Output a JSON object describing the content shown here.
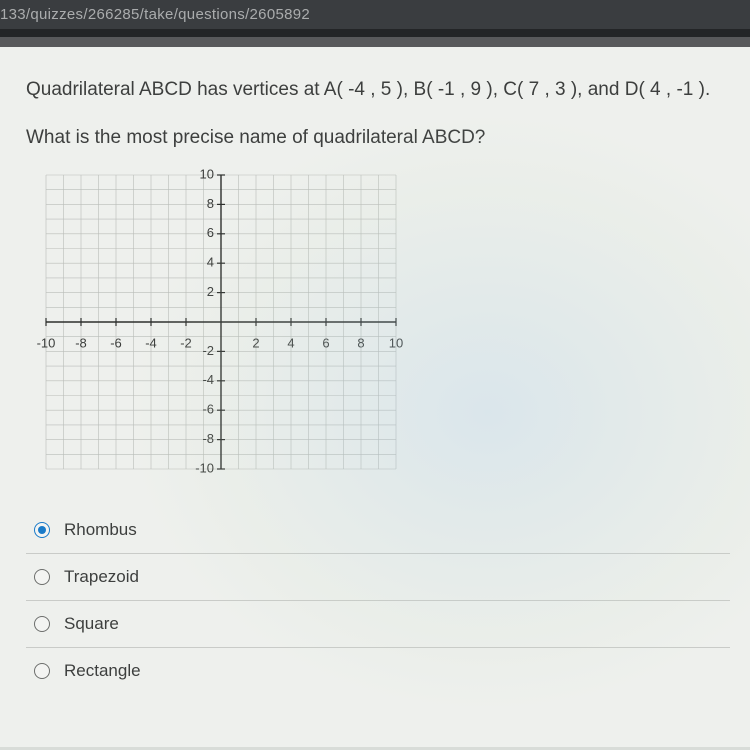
{
  "address_bar": "133/quizzes/266285/take/questions/2605892",
  "question": {
    "line1": "Quadrilateral ABCD has vertices at  A( -4 , 5 ),   B( -1 , 9 ),   C( 7 , 3 ), and   D( 4 , -1 ).",
    "line2": "What is the most precise name of quadrilateral ABCD?"
  },
  "chart_data": {
    "type": "scatter",
    "title": "",
    "xlabel": "",
    "ylabel": "",
    "xlim": [
      -10,
      10
    ],
    "ylim": [
      -10,
      10
    ],
    "x_ticks": [
      -10,
      -8,
      -6,
      -4,
      -2,
      2,
      4,
      6,
      8,
      10
    ],
    "y_ticks": [
      -10,
      -8,
      -6,
      -4,
      -2,
      2,
      4,
      6,
      8,
      10
    ],
    "grid": true,
    "series": []
  },
  "answers": [
    {
      "label": "Rhombus",
      "selected": true
    },
    {
      "label": "Trapezoid",
      "selected": false
    },
    {
      "label": "Square",
      "selected": false
    },
    {
      "label": "Rectangle",
      "selected": false
    }
  ]
}
